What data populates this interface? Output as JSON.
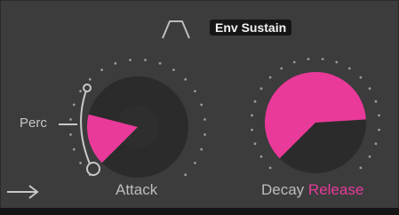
{
  "header": {
    "shape_icon": "envelope-shape-icon",
    "mode_label": "Env Sustain"
  },
  "attack": {
    "label": "Attack",
    "perc_label": "Perc",
    "value": 0.22
  },
  "decay_release": {
    "decay_label": "Decay",
    "release_label": "Release",
    "value": 0.82
  },
  "footer": {
    "arrow_icon": "right-arrow-icon"
  },
  "colors": {
    "accent": "#e93a9a",
    "panel": "#3c3c3c",
    "knob": "#2b2b2b"
  }
}
